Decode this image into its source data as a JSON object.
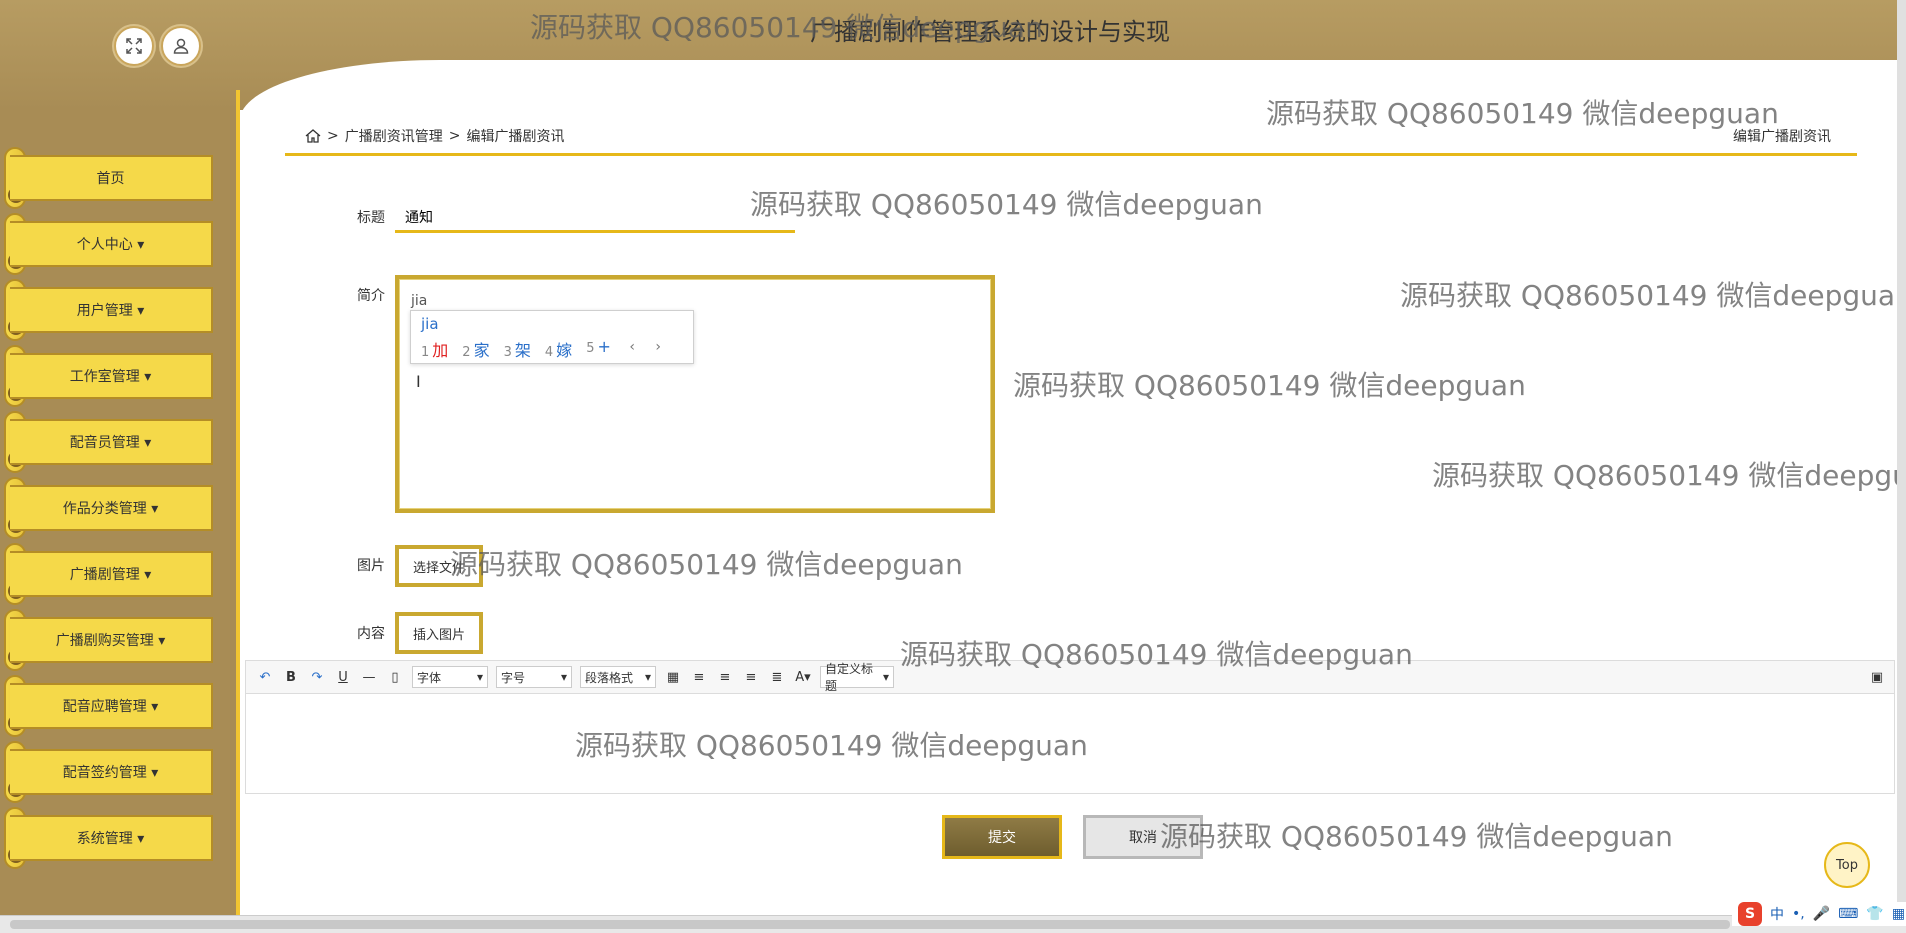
{
  "header": {
    "title": "广播剧制作管理系统的设计与实现"
  },
  "sidebar": {
    "items": [
      {
        "label": "首页"
      },
      {
        "label": "个人中心 ▾"
      },
      {
        "label": "用户管理 ▾"
      },
      {
        "label": "工作室管理 ▾"
      },
      {
        "label": "配音员管理 ▾"
      },
      {
        "label": "作品分类管理 ▾"
      },
      {
        "label": "广播剧管理 ▾"
      },
      {
        "label": "广播剧购买管理 ▾"
      },
      {
        "label": "配音应聘管理 ▾"
      },
      {
        "label": "配音签约管理 ▾"
      },
      {
        "label": "系统管理 ▾"
      }
    ]
  },
  "breadcrumb": {
    "sep": ">",
    "level1": "广播剧资讯管理",
    "level2": "编辑广播剧资讯",
    "right": "编辑广播剧资讯"
  },
  "form": {
    "title_label": "标题",
    "title_value": "通知",
    "summary_label": "简介",
    "summary_value": "jia",
    "image_label": "图片",
    "image_button": "选择文件",
    "content_label": "内容",
    "insert_image_button": "插入图片"
  },
  "ime": {
    "composition": "jia",
    "candidates": [
      {
        "num": "1",
        "text": "加"
      },
      {
        "num": "2",
        "text": "家"
      },
      {
        "num": "3",
        "text": "架"
      },
      {
        "num": "4",
        "text": "嫁"
      },
      {
        "num": "5",
        "text": "+"
      }
    ],
    "nav": "‹ ›"
  },
  "editor": {
    "font_select": "字体",
    "size_select": "字号",
    "para_select": "段落格式",
    "custom_select": "自定义标题"
  },
  "actions": {
    "submit": "提交",
    "cancel": "取消",
    "top": "Top"
  },
  "watermark": "源码获取 QQ86050149 微信deepguan",
  "tray": {
    "ime_mode": "中"
  }
}
